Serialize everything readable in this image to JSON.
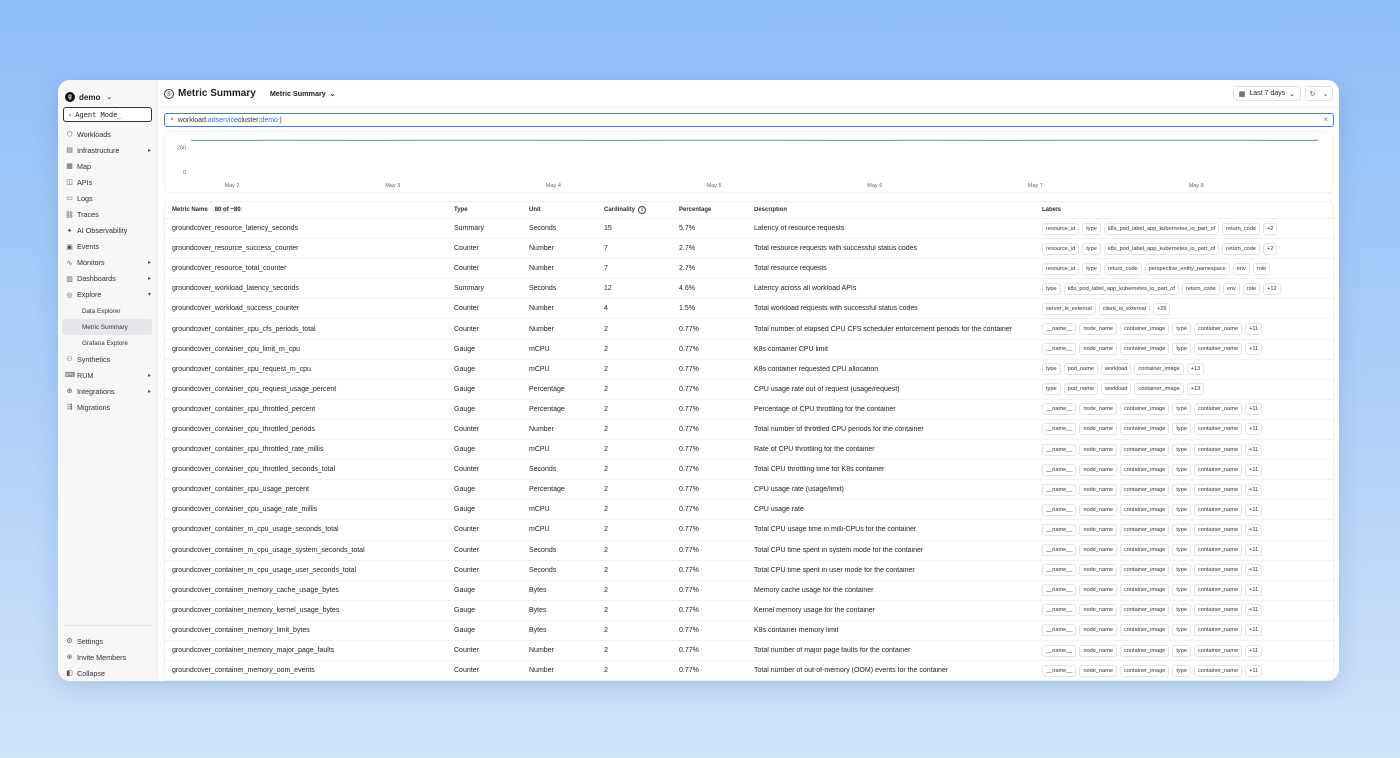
{
  "workspace": {
    "name": "demo",
    "logo": "g"
  },
  "agent_mode": "Agent Mode_",
  "nav": [
    {
      "icon": "workloads-icon",
      "glyph": "⬡",
      "label": "Workloads",
      "arrow": ""
    },
    {
      "icon": "infrastructure-icon",
      "glyph": "▤",
      "label": "Infrastructure",
      "arrow": "▸"
    },
    {
      "icon": "map-icon",
      "glyph": "▦",
      "label": "Map",
      "arrow": ""
    },
    {
      "icon": "apis-icon",
      "glyph": "◫",
      "label": "APIs",
      "arrow": ""
    },
    {
      "icon": "logs-icon",
      "glyph": "▭",
      "label": "Logs",
      "arrow": ""
    },
    {
      "icon": "traces-icon",
      "glyph": "⛓",
      "label": "Traces",
      "arrow": ""
    },
    {
      "icon": "ai-observability-icon",
      "glyph": "✦",
      "label": "AI Observability",
      "arrow": ""
    },
    {
      "icon": "events-icon",
      "glyph": "▣",
      "label": "Events",
      "arrow": ""
    },
    {
      "icon": "monitors-icon",
      "glyph": "∿",
      "label": "Monitors",
      "arrow": "▸"
    },
    {
      "icon": "dashboards-icon",
      "glyph": "▥",
      "label": "Dashboards",
      "arrow": "▸"
    },
    {
      "icon": "explore-icon",
      "glyph": "◎",
      "label": "Explore",
      "arrow": "▾"
    }
  ],
  "explore_sub": [
    "Data Explorer",
    "Metric Summary",
    "Grafana Explore"
  ],
  "nav2": [
    {
      "icon": "synthetics-icon",
      "glyph": "⚇",
      "label": "Synthetics",
      "arrow": ""
    },
    {
      "icon": "rum-icon",
      "glyph": "⌨",
      "label": "RUM",
      "arrow": "▸"
    },
    {
      "icon": "integrations-icon",
      "glyph": "⊕",
      "label": "Integrations",
      "arrow": "▸"
    },
    {
      "icon": "migrations-icon",
      "glyph": "⇶",
      "label": "Migrations",
      "arrow": ""
    }
  ],
  "bottom_nav": [
    {
      "icon": "settings-icon",
      "glyph": "⚙",
      "label": "Settings"
    },
    {
      "icon": "invite-icon",
      "glyph": "⊕",
      "label": "Invite Members"
    },
    {
      "icon": "collapse-icon",
      "glyph": "◧",
      "label": "Collapse"
    }
  ],
  "header": {
    "title": "Metric Summary",
    "view": "Metric Summary",
    "time_range": "Last 7 days"
  },
  "search": {
    "key1": "workload:",
    "val1": "adservice",
    "key2": " cluster:",
    "val2": "demo"
  },
  "chart_data": {
    "type": "line",
    "x": [
      "May 2",
      "May 3",
      "May 4",
      "May 5",
      "May 6",
      "May 7",
      "May 8"
    ],
    "yticks": [
      "200",
      "0"
    ],
    "ylim": [
      0,
      280
    ],
    "series": [
      {
        "values": [
          260,
          261,
          260,
          262,
          261,
          260,
          261,
          262,
          260,
          261,
          260,
          261,
          262,
          261,
          260
        ]
      }
    ],
    "grid": false,
    "color": "#4a90e2"
  },
  "table": {
    "headers": {
      "name": "Metric Name",
      "count": "80 of ~80",
      "type": "Type",
      "unit": "Unit",
      "cardinality": "Cardinality",
      "percentage": "Percentage",
      "description": "Description",
      "labels": "Labels"
    },
    "rows": [
      {
        "name": "groundcover_resource_latency_seconds",
        "type": "Summary",
        "unit": "Seconds",
        "card": "15",
        "pct": "5.7%",
        "desc": "Latency of resource requests",
        "labels": [
          "resource_id",
          "type",
          "k8s_pod_label_app_kubernetes_io_part_of",
          "return_code",
          "+2"
        ]
      },
      {
        "name": "groundcover_resource_success_counter",
        "type": "Counter",
        "unit": "Number",
        "card": "7",
        "pct": "2.7%",
        "desc": "Total resource requests with successful status codes",
        "labels": [
          "resource_id",
          "type",
          "k8s_pod_label_app_kubernetes_io_part_of",
          "return_code",
          "+2"
        ]
      },
      {
        "name": "groundcover_resource_total_counter",
        "type": "Counter",
        "unit": "Number",
        "card": "7",
        "pct": "2.7%",
        "desc": "Total resource requests",
        "labels": [
          "resource_id",
          "type",
          "return_code",
          "perspective_entity_namespace",
          "env",
          "role"
        ]
      },
      {
        "name": "groundcover_workload_latency_seconds",
        "type": "Summary",
        "unit": "Seconds",
        "card": "12",
        "pct": "4.6%",
        "desc": "Latency across all workload APIs",
        "labels": [
          "type",
          "k8s_pod_label_app_kubernetes_io_part_of",
          "return_code",
          "env",
          "role",
          "+12"
        ]
      },
      {
        "name": "groundcover_workload_success_counter",
        "type": "Counter",
        "unit": "Number",
        "card": "4",
        "pct": "1.5%",
        "desc": "Total workload requests with successful status codes",
        "labels": [
          "server_is_external",
          "client_is_external",
          "+26"
        ]
      },
      {
        "name": "groundcover_container_cpu_cfs_periods_total",
        "type": "Counter",
        "unit": "Number",
        "card": "2",
        "pct": "0.77%",
        "desc": "Total number of elapsed CPU CFS scheduler enforcement periods for the container",
        "labels": [
          "__name__",
          "node_name",
          "container_image",
          "type",
          "container_name",
          "+11"
        ]
      },
      {
        "name": "groundcover_container_cpu_limit_m_cpu",
        "type": "Gauge",
        "unit": "mCPU",
        "card": "2",
        "pct": "0.77%",
        "desc": "K8s container CPU limit",
        "labels": [
          "__name__",
          "node_name",
          "container_image",
          "type",
          "container_name",
          "+11"
        ]
      },
      {
        "name": "groundcover_container_cpu_request_m_cpu",
        "type": "Gauge",
        "unit": "mCPU",
        "card": "2",
        "pct": "0.77%",
        "desc": "K8s container requested CPU allocation",
        "labels": [
          "type",
          "pod_name",
          "workload",
          "container_image",
          "+13"
        ]
      },
      {
        "name": "groundcover_container_cpu_request_usage_percent",
        "type": "Gauge",
        "unit": "Percentage",
        "card": "2",
        "pct": "0.77%",
        "desc": "CPU usage rate out of request (usage/request)",
        "labels": [
          "type",
          "pod_name",
          "workload",
          "container_image",
          "+13"
        ]
      },
      {
        "name": "groundcover_container_cpu_throttled_percent",
        "type": "Gauge",
        "unit": "Percentage",
        "card": "2",
        "pct": "0.77%",
        "desc": "Percentage of CPU throttling for the container",
        "labels": [
          "__name__",
          "node_name",
          "container_image",
          "type",
          "container_name",
          "+11"
        ]
      },
      {
        "name": "groundcover_container_cpu_throttled_periods",
        "type": "Counter",
        "unit": "Number",
        "card": "2",
        "pct": "0.77%",
        "desc": "Total number of throttled CPU periods for the container",
        "labels": [
          "__name__",
          "node_name",
          "container_image",
          "type",
          "container_name",
          "+11"
        ]
      },
      {
        "name": "groundcover_container_cpu_throttled_rate_millis",
        "type": "Gauge",
        "unit": "mCPU",
        "card": "2",
        "pct": "0.77%",
        "desc": "Rate of CPU throttling for the container",
        "labels": [
          "__name__",
          "node_name",
          "container_image",
          "type",
          "container_name",
          "+11"
        ]
      },
      {
        "name": "groundcover_container_cpu_throttled_seconds_total",
        "type": "Counter",
        "unit": "Seconds",
        "card": "2",
        "pct": "0.77%",
        "desc": "Total CPU throttling time for K8s container",
        "labels": [
          "__name__",
          "node_name",
          "container_image",
          "type",
          "container_name",
          "+11"
        ]
      },
      {
        "name": "groundcover_container_cpu_usage_percent",
        "type": "Gauge",
        "unit": "Percentage",
        "card": "2",
        "pct": "0.77%",
        "desc": "CPU usage rate (usage/limit)",
        "labels": [
          "__name__",
          "node_name",
          "container_image",
          "type",
          "container_name",
          "+11"
        ]
      },
      {
        "name": "groundcover_container_cpu_usage_rate_millis",
        "type": "Gauge",
        "unit": "mCPU",
        "card": "2",
        "pct": "0.77%",
        "desc": "CPU usage rate",
        "labels": [
          "__name__",
          "node_name",
          "container_image",
          "type",
          "container_name",
          "+11"
        ]
      },
      {
        "name": "groundcover_container_m_cpu_usage_seconds_total",
        "type": "Counter",
        "unit": "mCPU",
        "card": "2",
        "pct": "0.77%",
        "desc": "Total CPU usage time in milli-CPUs for the container",
        "labels": [
          "__name__",
          "node_name",
          "container_image",
          "type",
          "container_name",
          "+11"
        ]
      },
      {
        "name": "groundcover_container_m_cpu_usage_system_seconds_total",
        "type": "Counter",
        "unit": "Seconds",
        "card": "2",
        "pct": "0.77%",
        "desc": "Total CPU time spent in system mode for the container",
        "labels": [
          "__name__",
          "node_name",
          "container_image",
          "type",
          "container_name",
          "+11"
        ]
      },
      {
        "name": "groundcover_container_m_cpu_usage_user_seconds_total",
        "type": "Counter",
        "unit": "Seconds",
        "card": "2",
        "pct": "0.77%",
        "desc": "Total CPU time spent in user mode for the container",
        "labels": [
          "__name__",
          "node_name",
          "container_image",
          "type",
          "container_name",
          "+11"
        ]
      },
      {
        "name": "groundcover_container_memory_cache_usage_bytes",
        "type": "Gauge",
        "unit": "Bytes",
        "card": "2",
        "pct": "0.77%",
        "desc": "Memory cache usage for the container",
        "labels": [
          "__name__",
          "node_name",
          "container_image",
          "type",
          "container_name",
          "+11"
        ]
      },
      {
        "name": "groundcover_container_memory_kernel_usage_bytes",
        "type": "Gauge",
        "unit": "Bytes",
        "card": "2",
        "pct": "0.77%",
        "desc": "Kernel memory usage for the container",
        "labels": [
          "__name__",
          "node_name",
          "container_image",
          "type",
          "container_name",
          "+11"
        ]
      },
      {
        "name": "groundcover_container_memory_limit_bytes",
        "type": "Gauge",
        "unit": "Bytes",
        "card": "2",
        "pct": "0.77%",
        "desc": "K8s container memory limit",
        "labels": [
          "__name__",
          "node_name",
          "container_image",
          "type",
          "container_name",
          "+11"
        ]
      },
      {
        "name": "groundcover_container_memory_major_page_faults",
        "type": "Counter",
        "unit": "Number",
        "card": "2",
        "pct": "0.77%",
        "desc": "Total number of major page faults for the container",
        "labels": [
          "__name__",
          "node_name",
          "container_image",
          "type",
          "container_name",
          "+11"
        ]
      },
      {
        "name": "groundcover_container_memory_oom_events",
        "type": "Counter",
        "unit": "Number",
        "card": "2",
        "pct": "0.77%",
        "desc": "Total number of out-of-memory (OOM) events for the container",
        "labels": [
          "__name__",
          "node_name",
          "container_image",
          "type",
          "container_name",
          "+11"
        ]
      }
    ]
  }
}
